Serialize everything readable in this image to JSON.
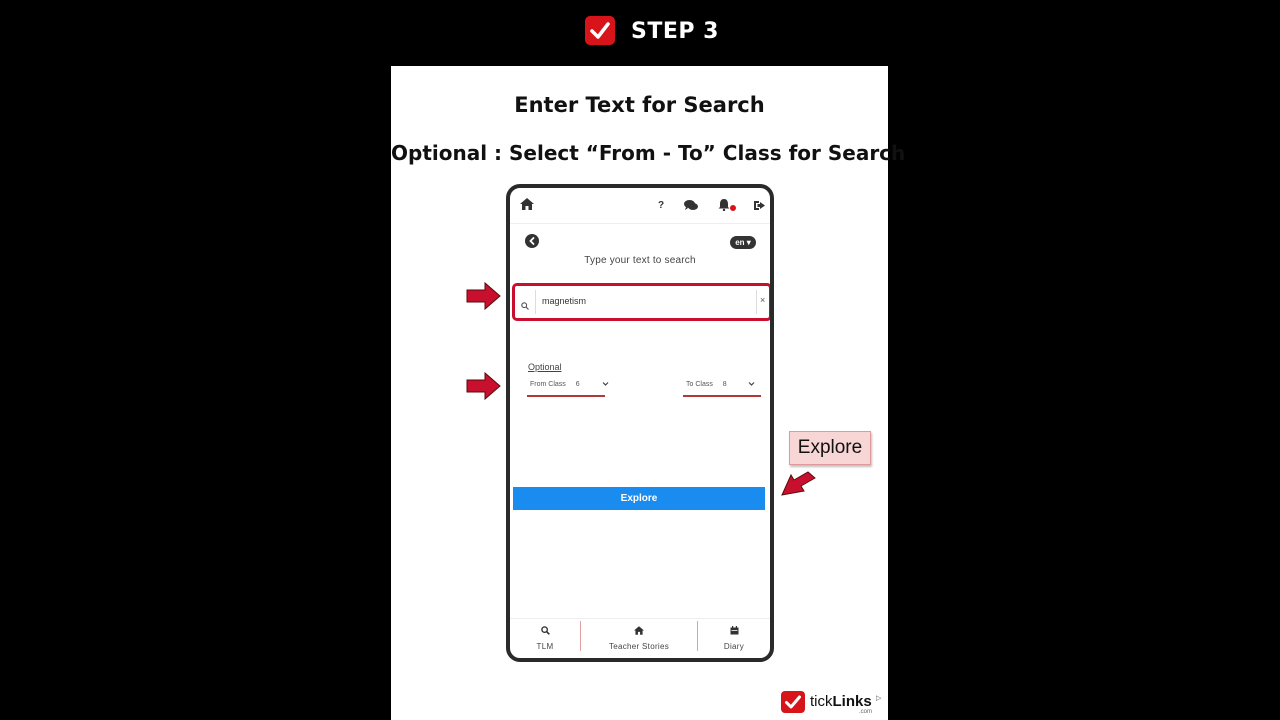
{
  "header": {
    "step_label": "STEP 3"
  },
  "instructions": {
    "line1": "Enter Text for Search",
    "line2": "Optional : Select “From - To” Class for Search"
  },
  "app": {
    "lang": "en",
    "help_glyph": "?",
    "search_title": "Type your text to search",
    "search_value": "magnetism",
    "clear_glyph": "×",
    "optional_label": "Optional",
    "from_label": "From Class",
    "from_value": "6",
    "to_label": "To Class",
    "to_value": "8",
    "explore_label": "Explore",
    "tabs": [
      {
        "label": "TLM",
        "icon": "search-icon"
      },
      {
        "label": "Teacher Stories",
        "icon": "home-icon"
      },
      {
        "label": "Diary",
        "icon": "calendar-icon"
      }
    ]
  },
  "callout": {
    "label": "Explore"
  },
  "brand": {
    "name_regular": "tick",
    "name_bold": "Links",
    "domain": ".com"
  },
  "colors": {
    "accent_red": "#d7141a",
    "highlight_border": "#c8102e",
    "explore_blue": "#1a8cf0",
    "callout_bg": "#f8d6d6"
  }
}
